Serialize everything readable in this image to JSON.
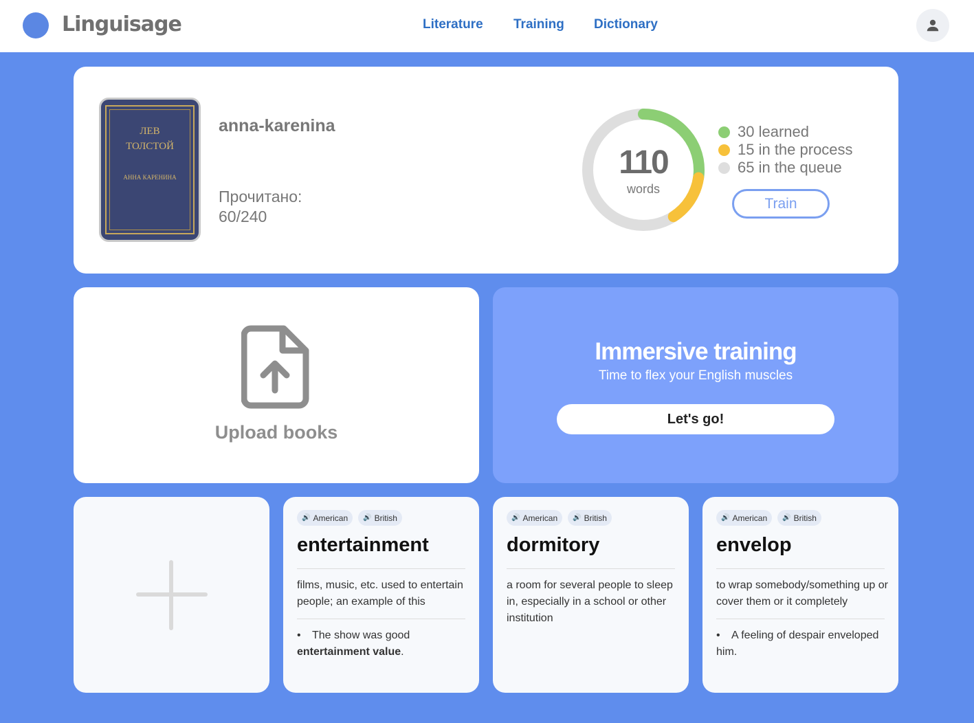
{
  "header": {
    "logo_text": "Linguisage",
    "nav": [
      {
        "label": "Literature"
      },
      {
        "label": "Training"
      },
      {
        "label": "Dictionary"
      }
    ]
  },
  "book": {
    "title": "anna-karenina",
    "cover": {
      "line1": "ЛЕВ",
      "line2": "ТОЛСТОЙ",
      "line3": "АННА КАРЕНИНА"
    },
    "read_label": "Прочитано:",
    "read_value": "60/240"
  },
  "words_stats": {
    "total": "110",
    "total_label": "words",
    "learned": 30,
    "in_process": 15,
    "in_queue": 65,
    "legend": [
      {
        "text": "30 learned",
        "color": "#8cce74"
      },
      {
        "text": "15 in the process",
        "color": "#f7c13a"
      },
      {
        "text": "65 in the queue",
        "color": "#dedede"
      }
    ],
    "train_label": "Train"
  },
  "upload": {
    "label": "Upload books"
  },
  "immersive": {
    "title": "Immersive training",
    "subtitle": "Time to flex your English muscles",
    "button_label": "Let's go!"
  },
  "accent_labels": {
    "american": "American",
    "british": "British"
  },
  "words": [
    {
      "word": "entertainment",
      "definition": "films, music, etc. used to entertain people; an example of this",
      "example_before": "The show was good ",
      "example_bold": "entertainment value",
      "example_after": "."
    },
    {
      "word": "dormitory",
      "definition": "a room for several people to sleep in, especially in a school or other institution",
      "example_before": "",
      "example_bold": "",
      "example_after": ""
    },
    {
      "word": "envelop",
      "definition": "to wrap somebody/something up or cover them or it completely",
      "example_before": "A feeling of despair enveloped him.",
      "example_bold": "",
      "example_after": ""
    }
  ]
}
